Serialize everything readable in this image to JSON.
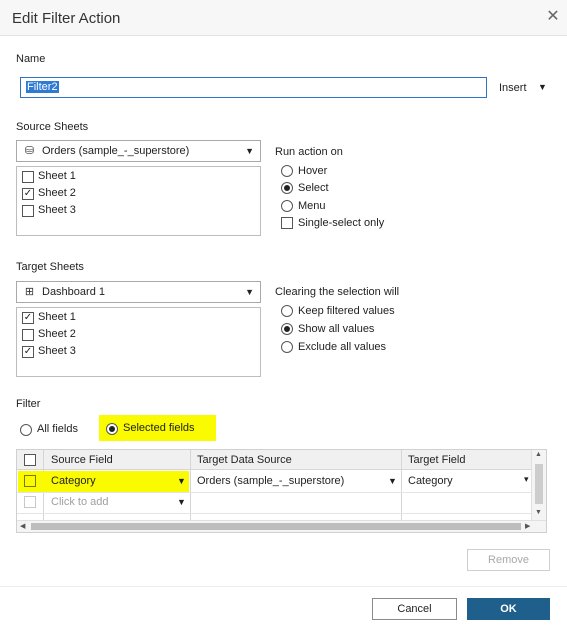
{
  "dialog": {
    "title": "Edit Filter Action",
    "close_icon": "close-icon"
  },
  "name": {
    "label": "Name",
    "value": "Filter2",
    "insert_label": "Insert"
  },
  "source_sheets": {
    "label": "Source Sheets",
    "datasource": "Orders (sample_-_superstore)",
    "datasource_icon": "database-icon",
    "sheets": [
      {
        "label": "Sheet 1",
        "checked": false
      },
      {
        "label": "Sheet 2",
        "checked": true
      },
      {
        "label": "Sheet 3",
        "checked": false
      }
    ]
  },
  "run_action_on": {
    "label": "Run action on",
    "options": [
      {
        "label": "Hover",
        "selected": false
      },
      {
        "label": "Select",
        "selected": true
      },
      {
        "label": "Menu",
        "selected": false
      }
    ],
    "single_select": {
      "label": "Single-select only",
      "checked": false
    }
  },
  "target_sheets": {
    "label": "Target Sheets",
    "dashboard": "Dashboard 1",
    "dashboard_icon": "dashboard-grid-icon",
    "sheets": [
      {
        "label": "Sheet 1",
        "checked": true
      },
      {
        "label": "Sheet 2",
        "checked": false
      },
      {
        "label": "Sheet 3",
        "checked": true
      }
    ]
  },
  "clearing": {
    "label": "Clearing the selection will",
    "options": [
      {
        "label": "Keep filtered values",
        "selected": false
      },
      {
        "label": "Show all values",
        "selected": true
      },
      {
        "label": "Exclude all values",
        "selected": false
      }
    ]
  },
  "filter": {
    "label": "Filter",
    "all_fields": "All fields",
    "selected_fields": "Selected fields",
    "mode": "selected_fields",
    "highlight_color": "#fafa00",
    "columns": [
      "Source Field",
      "Target Data Source",
      "Target Field"
    ],
    "rows": [
      {
        "source": "Category",
        "target_ds": "Orders (sample_-_superstore)",
        "target_field": "Category"
      }
    ],
    "add_placeholder": "Click to add"
  },
  "buttons": {
    "remove": "Remove",
    "cancel": "Cancel",
    "ok": "OK",
    "ok_color": "#1f5f8b"
  }
}
